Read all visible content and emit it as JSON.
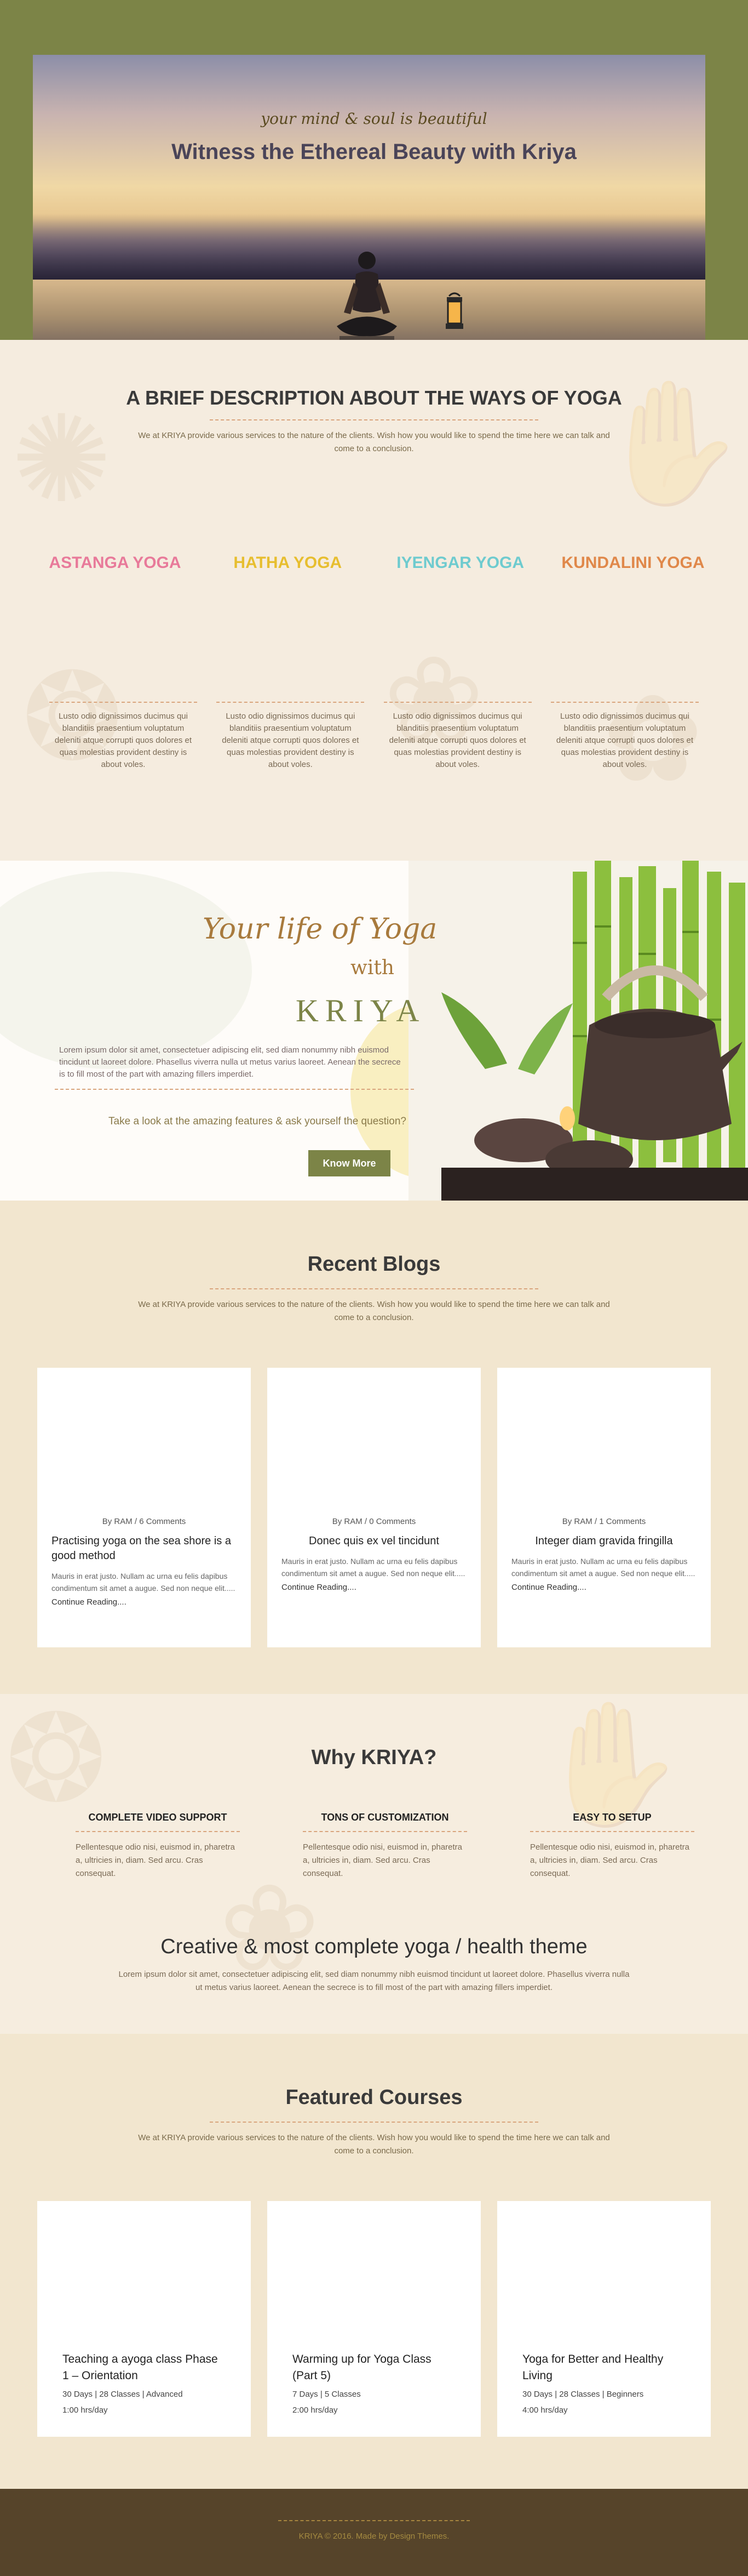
{
  "hero": {
    "subtitle": "your mind & soul is beautiful",
    "title": "Witness the Ethereal Beauty with Kriya"
  },
  "ways": {
    "title": "A BRIEF DESCRIPTION ABOUT THE WAYS OF YOGA",
    "description": "We at KRIYA provide various services to the nature of the clients. Wish how you would like to spend the time here we can talk and come to a conclusion.",
    "types": [
      {
        "label": "ASTANGA YOGA",
        "color": "#e87a9a"
      },
      {
        "label": "HATHA YOGA",
        "color": "#e7be2f"
      },
      {
        "label": "IYENGAR YOGA",
        "color": "#6ecbcf"
      },
      {
        "label": "KUNDALINI YOGA",
        "color": "#e0884a"
      }
    ],
    "columns": [
      "Lusto odio dignissimos ducimus qui blanditiis praesentium voluptatum deleniti atque corrupti quos dolores et quas molestias provident destiny is about voles.",
      "Lusto odio dignissimos ducimus qui blanditiis praesentium voluptatum deleniti atque corrupti quos dolores et quas molestias provident destiny is about voles.",
      "Lusto odio dignissimos ducimus qui blanditiis praesentium voluptatum deleniti atque corrupti quos dolores et quas molestias provident destiny is about voles.",
      "Lusto odio dignissimos ducimus qui blanditiis praesentium voluptatum deleniti atque corrupti quos dolores et quas molestias provident destiny is about voles."
    ]
  },
  "life": {
    "heading": "Your life of Yoga",
    "with": "with",
    "brand": "KRIYA",
    "text": "Lorem ipsum dolor sit amet, consectetuer adipiscing elit, sed diam nonummy nibh euismod tincidunt ut laoreet dolore. Phasellus viverra nulla ut metus varius laoreet. Aenean the secrece is to fill most of the part with amazing fillers imperdiet.",
    "question": "Take a look at the amazing features & ask yourself the question?",
    "button": "Know More"
  },
  "blogs": {
    "title": "Recent Blogs",
    "description": "We at KRIYA provide various services to the nature of the clients. Wish how you would like to spend the time here we can talk and come to a conclusion.",
    "items": [
      {
        "meta": "By RAM / 6 Comments",
        "title": "Practising yoga on the sea shore is a good method",
        "body": "Mauris in erat justo. Nullam ac urna eu felis dapibus condimentum sit amet a augue. Sed non neque elit.....",
        "link": "Continue Reading...."
      },
      {
        "meta": "By RAM / 0 Comments",
        "title": "Donec quis ex vel tincidunt",
        "body": "Mauris in erat justo. Nullam ac urna eu felis dapibus condimentum sit amet a augue. Sed non neque elit.....",
        "link": "Continue Reading...."
      },
      {
        "meta": "By RAM / 1 Comments",
        "title": "Integer diam gravida fringilla",
        "body": "Mauris in erat justo. Nullam ac urna eu felis dapibus condimentum sit amet a augue. Sed non neque elit.....",
        "link": "Continue Reading...."
      }
    ]
  },
  "why": {
    "title": "Why KRIYA?",
    "items": [
      {
        "title": "COMPLETE VIDEO SUPPORT",
        "body": "Pellentesque odio nisi, euismod in, pharetra a, ultricies in, diam. Sed arcu. Cras consequat."
      },
      {
        "title": "TONS OF CUSTOMIZATION",
        "body": "Pellentesque odio nisi, euismod in, pharetra a, ultricies in, diam. Sed arcu. Cras consequat."
      },
      {
        "title": "EASY TO SETUP",
        "body": "Pellentesque odio nisi, euismod in, pharetra a, ultricies in, diam. Sed arcu. Cras consequat."
      }
    ],
    "creative_title": "Creative & most complete yoga / health theme",
    "creative_text": "Lorem ipsum dolor sit amet, consectetuer adipiscing elit, sed diam nonummy nibh euismod tincidunt ut laoreet dolore. Phasellus viverra nulla ut metus varius laoreet. Aenean the secrece is to fill most of the part with amazing fillers imperdiet."
  },
  "courses": {
    "title": "Featured Courses",
    "description": "We at KRIYA provide various services to the nature of the clients. Wish how you would like to spend the time here we can talk and come to a conclusion.",
    "items": [
      {
        "title": "Teaching a ayoga class Phase 1 – Orientation",
        "meta": "30 Days | 28 Classes | Advanced",
        "time": "1:00 hrs/day"
      },
      {
        "title": "Warming up for Yoga Class (Part 5)",
        "meta": "7 Days | 5 Classes",
        "time": "2:00 hrs/day"
      },
      {
        "title": "Yoga for Better and Healthy Living",
        "meta": "30 Days | 28 Classes | Beginners",
        "time": "4:00 hrs/day"
      }
    ]
  },
  "footer": {
    "text": "KRIYA © 2016. Made by Design Themes."
  },
  "colors": {
    "olive": "#7c8447",
    "accent_dash": "#d9a57d",
    "footer_bg": "#56442a"
  }
}
